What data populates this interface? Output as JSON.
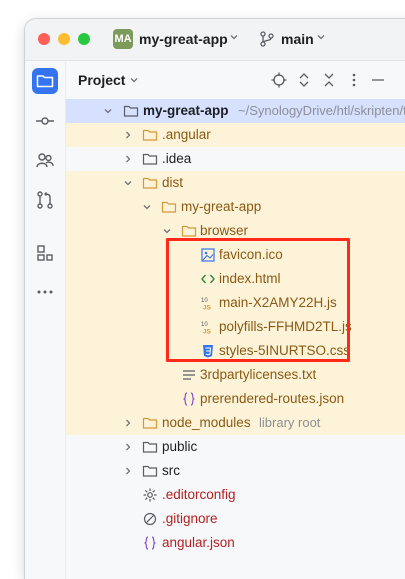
{
  "titlebar": {
    "project_badge": "MA",
    "project_name": "my-great-app",
    "branch_name": "main"
  },
  "sidebar": {
    "items": [
      {
        "name": "project-tool-icon",
        "active": true
      },
      {
        "name": "commit-tool-icon"
      },
      {
        "name": "vcs-tool-icon"
      },
      {
        "name": "pull-requests-tool-icon"
      },
      {
        "name": "structure-tool-icon"
      },
      {
        "name": "more-tools-icon"
      }
    ]
  },
  "panel": {
    "title": "Project",
    "header_icons": [
      "locate-icon",
      "expand-all-icon",
      "collapse-all-icon",
      "options-icon",
      "hide-icon"
    ]
  },
  "tree": {
    "root": {
      "name": "my-great-app",
      "path": "~/SynologyDrive/htl/skripten/th"
    },
    "items": [
      {
        "name": ".angular",
        "type": "folder"
      },
      {
        "name": ".idea",
        "type": "folder"
      },
      {
        "name": "dist",
        "type": "folder"
      },
      {
        "name": "my-great-app",
        "type": "folder"
      },
      {
        "name": "browser",
        "type": "folder"
      },
      {
        "name": "favicon.ico",
        "type": "image"
      },
      {
        "name": "index.html",
        "type": "html"
      },
      {
        "name": "main-X2AMY22H.js",
        "type": "js"
      },
      {
        "name": "polyfills-FFHMD2TL.js",
        "type": "js"
      },
      {
        "name": "styles-5INURTSO.css",
        "type": "css"
      },
      {
        "name": "3rdpartylicenses.txt",
        "type": "text"
      },
      {
        "name": "prerendered-routes.json",
        "type": "json"
      },
      {
        "name": "node_modules",
        "type": "folder",
        "suffix": "library root"
      },
      {
        "name": "public",
        "type": "folder"
      },
      {
        "name": "src",
        "type": "folder"
      },
      {
        "name": ".editorconfig",
        "type": "config"
      },
      {
        "name": ".gitignore",
        "type": "ignore"
      },
      {
        "name": "angular.json",
        "type": "json"
      }
    ]
  },
  "colors": {
    "accent": "#3574f0",
    "highlight_box": "#ff2a1a",
    "excluded_background": "#fdf3d8",
    "selected_row": "#d5e1ff"
  }
}
